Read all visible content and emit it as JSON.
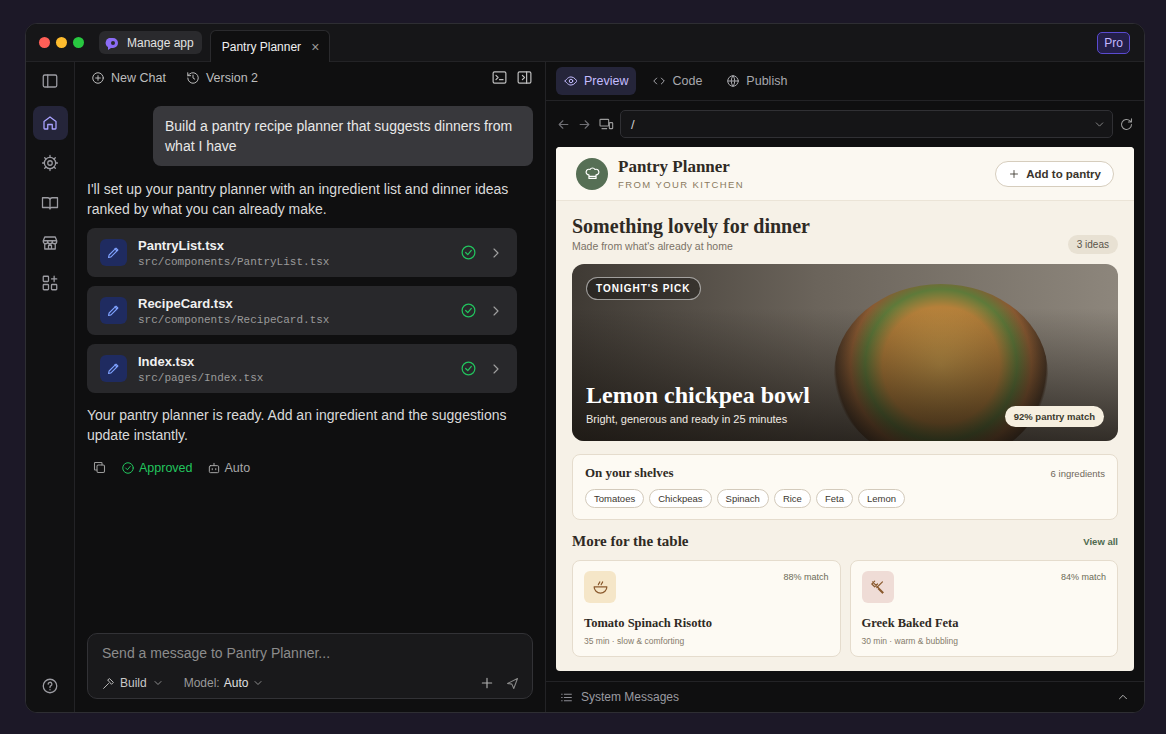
{
  "window": {
    "tabs": [
      {
        "label": "Manage app",
        "selected": false
      },
      {
        "label": "Pantry Planner",
        "selected": true,
        "close": "×"
      }
    ],
    "badge": "Pro"
  },
  "sidebar": {
    "items": [
      {
        "selected": false
      },
      {
        "selected": true
      },
      {
        "selected": false
      },
      {
        "selected": false
      },
      {
        "selected": false
      },
      {
        "selected": false
      }
    ],
    "help": {
      "selected": false
    }
  },
  "chat": {
    "new_chat": "New Chat",
    "version": "Version 2",
    "user_message": "Build a pantry recipe planner that suggests dinners from what I have",
    "reply_intro": "I'll set up your pantry planner with an ingredient list and dinner ideas ranked by what you can already make.",
    "files": [
      {
        "name": "PantryList.tsx",
        "path": "src/components/PantryList.tsx",
        "done": true
      },
      {
        "name": "RecipeCard.tsx",
        "path": "src/components/RecipeCard.tsx",
        "done": true
      },
      {
        "name": "Index.tsx",
        "path": "src/pages/Index.tsx",
        "done": true
      }
    ],
    "reply_outro": "Your pantry planner is ready. Add an ingredient and the suggestions update instantly.",
    "status": {
      "approved": "Approved",
      "auto": "Auto"
    },
    "composer": {
      "placeholder": "Send a message to Pantry Planner...",
      "mode": "Build",
      "model_label": "Model:",
      "model": "Auto"
    }
  },
  "preview": {
    "tabs": [
      {
        "label": "Preview",
        "selected": true
      },
      {
        "label": "Code",
        "selected": false
      },
      {
        "label": "Publish",
        "selected": false
      }
    ],
    "url": "/",
    "system_messages": "System Messages",
    "app": {
      "brand": "Pantry Planner",
      "tagline": "FROM YOUR KITCHEN",
      "add_button": "Add to pantry",
      "heading": "Something lovely for dinner",
      "subheading": "Made from what's already at home",
      "idea_count": "3 ideas",
      "hero": {
        "badge": "TONIGHT'S PICK",
        "title": "Lemon chickpea bowl",
        "description": "Bright, generous and ready in 25 minutes",
        "match": "92% pantry match"
      },
      "shelves": {
        "title": "On your shelves",
        "count": "6 ingredients",
        "items": [
          "Tomatoes",
          "Chickpeas",
          "Spinach",
          "Rice",
          "Feta",
          "Lemon"
        ]
      },
      "more": {
        "title": "More for the table",
        "link": "View all",
        "cards": [
          {
            "title": "Tomato Spinach Risotto",
            "meta": "35 min · slow & comforting",
            "match": "88% match",
            "color": "#f5e6c8"
          },
          {
            "title": "Greek Baked Feta",
            "meta": "30 min · warm & bubbling",
            "match": "84% match",
            "color": "#efdcd6"
          }
        ]
      }
    }
  }
}
